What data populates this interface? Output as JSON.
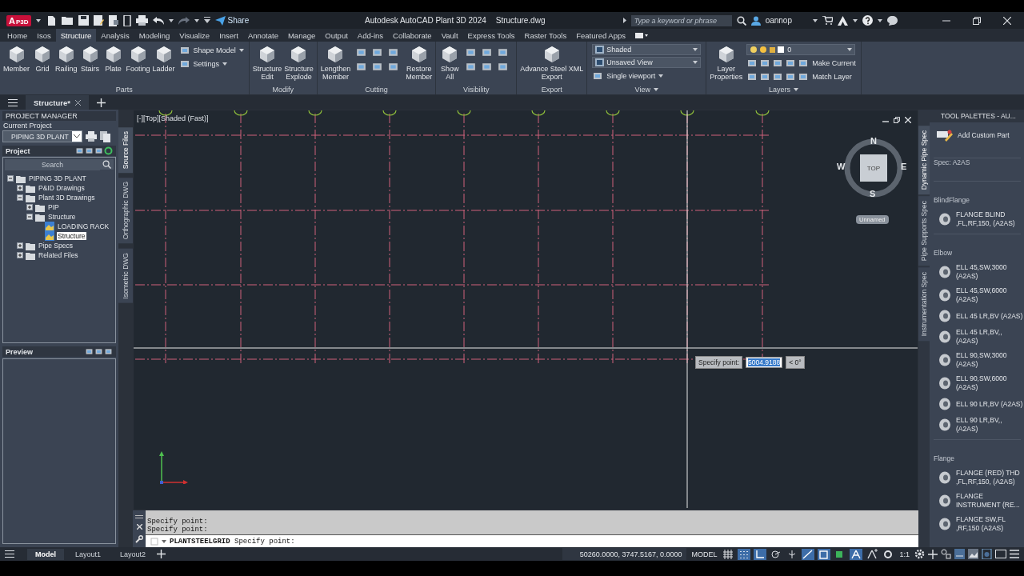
{
  "title_bar": {
    "badge": "A",
    "badge_sub": "P3D",
    "share": "Share",
    "title": "Autodesk AutoCAD Plant 3D 2024",
    "file": "Structure.dwg",
    "search_placeholder": "Type a keyword or phrase",
    "user": "oannop"
  },
  "ribbon_tabs": [
    {
      "label": "Home",
      "selected": false
    },
    {
      "label": "Isos",
      "selected": false
    },
    {
      "label": "Structure",
      "selected": true
    },
    {
      "label": "Analysis",
      "selected": false
    },
    {
      "label": "Modeling",
      "selected": false
    },
    {
      "label": "Visualize",
      "selected": false
    },
    {
      "label": "Insert",
      "selected": false
    },
    {
      "label": "Annotate",
      "selected": false
    },
    {
      "label": "Manage",
      "selected": false
    },
    {
      "label": "Output",
      "selected": false
    },
    {
      "label": "Add-ins",
      "selected": false
    },
    {
      "label": "Collaborate",
      "selected": false
    },
    {
      "label": "Vault",
      "selected": false
    },
    {
      "label": "Express Tools",
      "selected": false
    },
    {
      "label": "Raster Tools",
      "selected": false
    },
    {
      "label": "Featured Apps",
      "selected": false
    }
  ],
  "ribbon_panels": [
    {
      "title": "Parts",
      "title_menu": false,
      "items": [
        {
          "kind": "large",
          "lines": [
            "Member"
          ]
        },
        {
          "kind": "large",
          "lines": [
            "Grid"
          ]
        },
        {
          "kind": "large",
          "lines": [
            "Railing"
          ]
        },
        {
          "kind": "large",
          "lines": [
            "Stairs"
          ]
        },
        {
          "kind": "large",
          "lines": [
            "Plate"
          ]
        },
        {
          "kind": "large",
          "lines": [
            "Footing"
          ]
        },
        {
          "kind": "large",
          "lines": [
            "Ladder"
          ]
        },
        {
          "kind": "stack",
          "entries": [
            {
              "label": "Shape Model",
              "menu": true
            },
            {
              "label": "Settings",
              "menu": true
            }
          ]
        }
      ]
    },
    {
      "title": "Modify",
      "title_menu": false,
      "items": [
        {
          "kind": "large",
          "lines": [
            "Structure",
            "Edit"
          ]
        },
        {
          "kind": "large",
          "lines": [
            "Structure",
            "Explode"
          ]
        }
      ]
    },
    {
      "title": "Cutting",
      "title_menu": false,
      "items": [
        {
          "kind": "large",
          "lines": [
            "Lengthen",
            "Member"
          ]
        },
        {
          "kind": "icon_grid"
        },
        {
          "kind": "large",
          "lines": [
            "Restore",
            "Member"
          ]
        }
      ]
    },
    {
      "title": "Visibility",
      "title_menu": false,
      "items": [
        {
          "kind": "large",
          "lines": [
            "Show",
            "All"
          ]
        },
        {
          "kind": "icon_grid"
        }
      ]
    },
    {
      "title": "Export",
      "title_menu": false,
      "items": [
        {
          "kind": "large",
          "lines": [
            "Advance Steel XML",
            "Export"
          ]
        }
      ]
    },
    {
      "title": "View",
      "title_menu": true,
      "items": [
        {
          "kind": "stack",
          "dropdowns": [
            "Shaded",
            "Unsaved View"
          ],
          "entries": [
            {
              "label": "Single viewport",
              "menu": true
            }
          ]
        }
      ]
    },
    {
      "title": "Layers",
      "title_menu": true,
      "items": [
        {
          "kind": "large",
          "lines": [
            "Layer",
            "Properties"
          ]
        },
        {
          "kind": "layer_stack",
          "dropdown": "0",
          "entries": [
            {
              "label": "Make Current",
              "menu": false
            },
            {
              "label": "Match Layer",
              "menu": false
            }
          ]
        }
      ]
    }
  ],
  "file_tabs": [
    {
      "label": "Structure*",
      "selected": true
    }
  ],
  "project_manager": {
    "title": "PROJECT MANAGER",
    "current_project_label": "Current Project",
    "current_project": "PIPING 3D PLANT",
    "project_label": "Project",
    "search_placeholder": "Search",
    "preview_label": "Preview",
    "tree": [
      {
        "label": "PIPING 3D PLANT",
        "expanded": true,
        "selected": false,
        "children": [
          {
            "label": "P&ID Drawings",
            "expanded": false,
            "selected": false
          },
          {
            "label": "Plant 3D Drawings",
            "expanded": true,
            "selected": false,
            "children": [
              {
                "label": "PIP",
                "expanded": false,
                "selected": false
              },
              {
                "label": "Structure",
                "expanded": true,
                "selected": false,
                "children": [
                  {
                    "label": "LOADING RACK",
                    "selected": false
                  },
                  {
                    "label": "Structure",
                    "selected": true
                  }
                ]
              }
            ]
          },
          {
            "label": "Pipe Specs",
            "expanded": false,
            "selected": false
          },
          {
            "label": "Related Files",
            "expanded": false,
            "selected": false
          }
        ]
      }
    ]
  },
  "side_tabs": [
    {
      "label": "Source Files",
      "selected": true
    },
    {
      "label": "Orthographic DWG",
      "selected": false
    },
    {
      "label": "Isometric DWG",
      "selected": false
    }
  ],
  "viewport": {
    "label": "[-][Top][Shaded (Fast)]",
    "compass": {
      "north": "N",
      "south": "S",
      "east": "E",
      "west": "W",
      "face": "TOP"
    },
    "ucs_name": "Unnamed",
    "prompt": {
      "label": "Specify point:",
      "value": "5004.9188",
      "angle": "< 0°"
    }
  },
  "command_line": {
    "history": [
      "Specify point:",
      "Specify point:"
    ],
    "command": "PLANTSTEELGRID",
    "prompt": "Specify point:"
  },
  "tool_palette": {
    "title": "TOOL PALETTES - AU...",
    "tabs": [
      {
        "label": "Dynamic Pipe Spec",
        "selected": true
      },
      {
        "label": "Pipe Supports Spec",
        "selected": false
      },
      {
        "label": "Instrumentation Spec",
        "selected": false
      }
    ],
    "add_custom": "Add Custom Part",
    "spec": "Spec: A2AS",
    "sections": [
      {
        "title": "BlindFlange",
        "items": [
          "FLANGE BLIND ,FL,RF,150, (A2AS)"
        ]
      },
      {
        "title": "Elbow",
        "items": [
          "ELL 45,SW,3000 (A2AS)",
          "ELL 45,SW,6000 (A2AS)",
          "ELL 45 LR,BV (A2AS)",
          "ELL 45 LR,BV,, (A2AS)",
          "ELL 90,SW,3000 (A2AS)",
          "ELL 90,SW,6000 (A2AS)",
          "ELL 90 LR,BV (A2AS)",
          "ELL 90 LR,BV,, (A2AS)"
        ]
      },
      {
        "title": "Flange",
        "items": [
          "FLANGE (RED) THD ,FL,RF,150, (A2AS)",
          "FLANGE INSTRUMENT  (RE...",
          "FLANGE SW,FL ,RF,150 (A2AS)"
        ]
      }
    ]
  },
  "layout_tabs": [
    {
      "label": "Model",
      "selected": true
    },
    {
      "label": "Layout1",
      "selected": false
    },
    {
      "label": "Layout2",
      "selected": false
    }
  ],
  "status_bar": {
    "coordinates": "50260.0000, 3747.5167, 0.0000",
    "space": "MODEL",
    "scale": "1:1",
    "toggles": [
      {
        "kind": "grid",
        "on": false
      },
      {
        "kind": "snap",
        "on": true
      },
      {
        "kind": "ortho",
        "on": true
      },
      {
        "kind": "polar",
        "on": false
      },
      {
        "kind": "isodraft",
        "on": false
      },
      {
        "kind": "tracking",
        "on": true
      },
      {
        "kind": "osnap",
        "on": true
      },
      {
        "kind": "transparency",
        "on": false
      },
      {
        "kind": "annotation",
        "on": true
      },
      {
        "kind": "autoscale",
        "on": false
      },
      {
        "kind": "workspace",
        "on": false
      }
    ]
  }
}
